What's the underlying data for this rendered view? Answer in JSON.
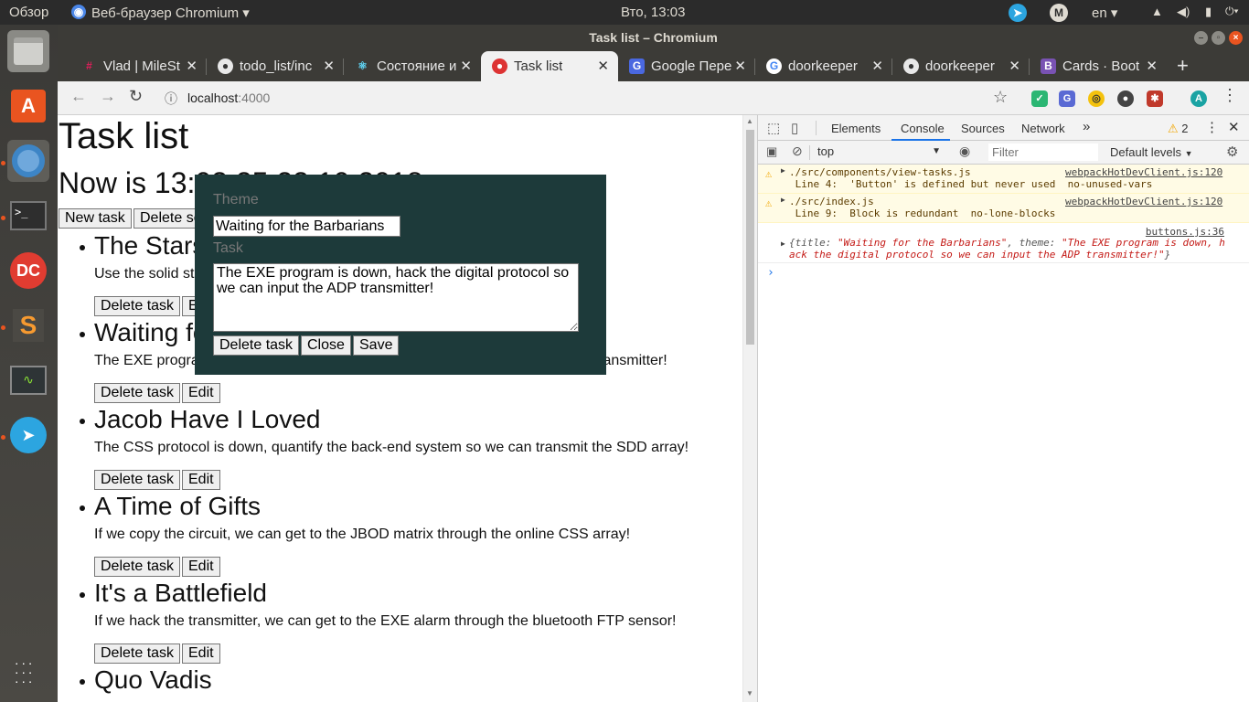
{
  "topbar": {
    "overview": "Обзор",
    "app_name": "Веб-браузер Chromium",
    "clock": "Вто, 13:03",
    "lang": "en"
  },
  "launcher": {
    "items": [
      "files-icon",
      "software-center-icon",
      "chromium-icon",
      "terminal-icon",
      "dconf-icon",
      "sublime-text-icon",
      "system-monitor-icon",
      "telegram-icon"
    ]
  },
  "window": {
    "title": "Task list – Chromium"
  },
  "tabs": [
    {
      "label": "Vlad | MileSt",
      "icon": "slack-icon"
    },
    {
      "label": "todo_list/inc",
      "icon": "github-icon"
    },
    {
      "label": "Состояние и",
      "icon": "react-icon"
    },
    {
      "label": "Task list",
      "icon": "mushroom-icon"
    },
    {
      "label": "Google Пере",
      "icon": "google-translate-icon"
    },
    {
      "label": "doorkeeper",
      "icon": "google-icon"
    },
    {
      "label": "doorkeeper",
      "icon": "github-icon"
    },
    {
      "label": "Cards · Boot",
      "icon": "bootstrap-icon"
    }
  ],
  "omnibox": {
    "host": "localhost",
    "port": ":4000"
  },
  "page": {
    "title": "Task list",
    "now_text": "Now is 13:03:25 23.10.2018",
    "new_task_label": "New task",
    "delete_selected_label": "Delete selected",
    "delete_task_label": "Delete task",
    "edit_label": "Edit",
    "tasks": [
      {
        "title": "The Stars, Tennis Balls",
        "desc": "Use the solid state SDD driver, then you can navigate the neural application!"
      },
      {
        "title": "Waiting for the Barbarians",
        "desc": "The EXE program is down, hack the digital protocol so we can input the ADP transmitter!"
      },
      {
        "title": "Jacob Have I Loved",
        "desc": "The CSS protocol is down, quantify the back-end system so we can transmit the SDD array!"
      },
      {
        "title": "A Time of Gifts",
        "desc": "If we copy the circuit, we can get to the JBOD matrix through the online CSS array!"
      },
      {
        "title": "It's a Battlefield",
        "desc": "If we hack the transmitter, we can get to the EXE alarm through the bluetooth FTP sensor!"
      },
      {
        "title": "Quo Vadis",
        "desc": ""
      }
    ]
  },
  "modal": {
    "theme_label": "Theme",
    "theme_value": "Waiting for the Barbarians",
    "task_label": "Task",
    "task_value": "The EXE program is down, hack the digital protocol so we can input the ADP transmitter!",
    "delete_label": "Delete task",
    "close_label": "Close",
    "save_label": "Save"
  },
  "devtools": {
    "tabs": [
      "Elements",
      "Console",
      "Sources",
      "Network"
    ],
    "active_tab": "Console",
    "warning_count": "2",
    "context": "top",
    "filter_placeholder": "Filter",
    "levels": "Default levels",
    "warnings": [
      {
        "file": "./src/components/view-tasks.js",
        "line": "Line 4:  'Button' is defined but never used  no-unused-vars",
        "source": "webpackHotDevClient.js:120"
      },
      {
        "file": "./src/index.js",
        "line": "Line 9:  Block is redundant  no-lone-blocks",
        "source": "webpackHotDevClient.js:120"
      }
    ],
    "log": {
      "source": "buttons.js:36",
      "line1_a": "{title: ",
      "line1_b": "\"Waiting for the Barbarians\"",
      "line1_c": ", theme: ",
      "line1_d": "\"The EXE program is down, h",
      "line2": "ack the digital protocol so we can input the ADP transmitter!\"",
      "line2_end": "}"
    }
  },
  "colors": {
    "modal_bg": "#1d3a3a",
    "accent": "#1a73e8",
    "ubuntu_orange": "#e95420"
  }
}
